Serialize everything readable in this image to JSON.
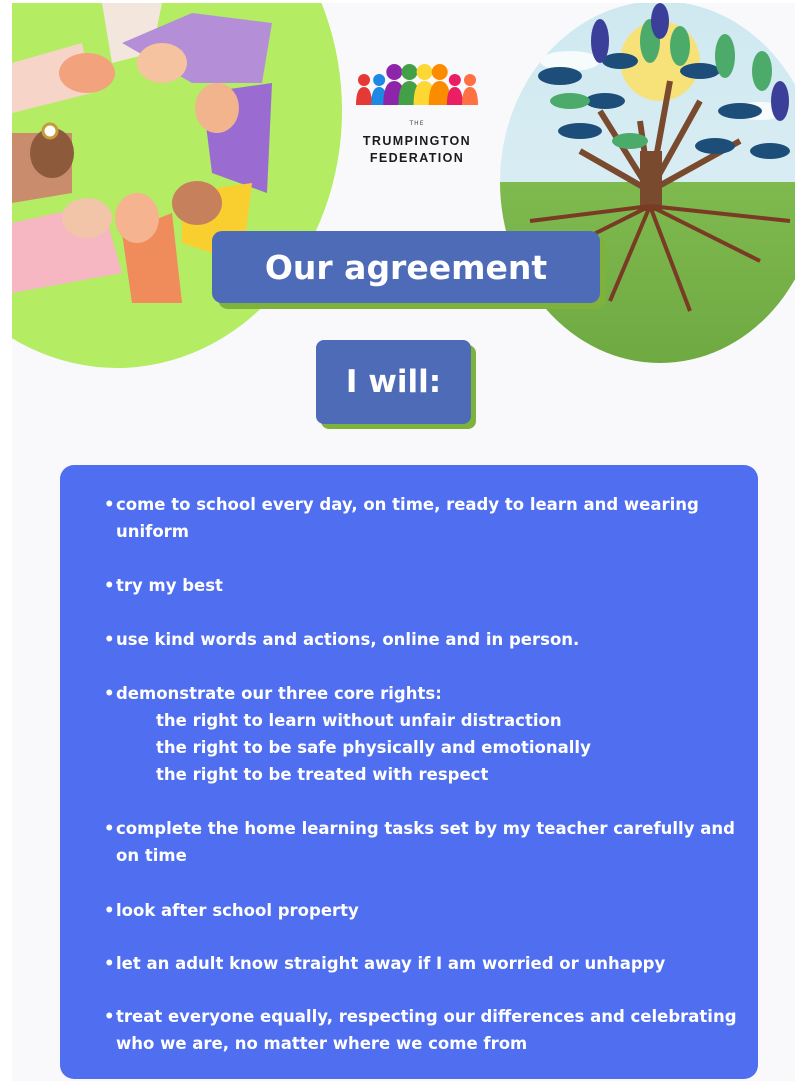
{
  "header": {
    "logo": {
      "small_text": "THE",
      "line1": "TRUMPINGTON",
      "line2": "FEDERATION",
      "figure_colors": [
        "#e53935",
        "#1e88e5",
        "#8e24aa",
        "#43a047",
        "#fdd835",
        "#fb8c00",
        "#e91e63",
        "#ff7043"
      ]
    },
    "title": "Our agreement",
    "subtitle": "I will:"
  },
  "colors": {
    "banner": "#4e6bb8",
    "banner_shadow": "#7fb23c",
    "panel": "#4f6ef0",
    "circle_green": "#b4ec63"
  },
  "agreement": {
    "items": [
      {
        "bullet": "•",
        "text": "come to school every day, on time, ready to learn and wearing uniform"
      },
      {
        "bullet": "•",
        "text": "try my best"
      },
      {
        "bullet": "•",
        "text": "use kind words and actions, online and in person."
      },
      {
        "bullet": "•",
        "text": "demonstrate our three core rights:",
        "sub": [
          "the right to learn without unfair distraction",
          "the right to be safe physically and emotionally",
          "the right to be treated with respect"
        ]
      },
      {
        "bullet": "•",
        "text": "complete the home learning tasks set by my teacher carefully and on time"
      },
      {
        "bullet": "•",
        "text": "look after school property"
      },
      {
        "bullet": "•",
        "text": "let an adult know straight away if I am worried or unhappy"
      },
      {
        "bullet": "•",
        "text": "treat everyone equally, respecting our differences and celebrating who we are, no matter where we come from"
      }
    ]
  }
}
